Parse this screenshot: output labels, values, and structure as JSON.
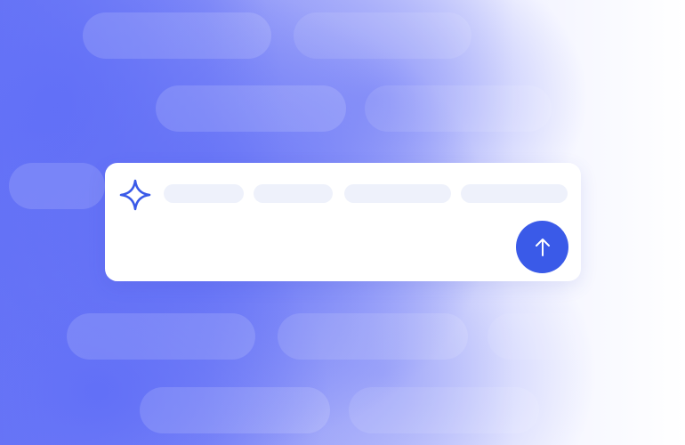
{
  "composer": {
    "send_action": "send",
    "placeholder_lines": 4
  },
  "icons": {
    "sparkle": "sparkle-icon",
    "send": "arrow-up-icon"
  },
  "colors": {
    "accent": "#3a5ae8",
    "background_blue": "#6a77f6",
    "placeholder": "#eef1fb",
    "card": "#ffffff"
  }
}
